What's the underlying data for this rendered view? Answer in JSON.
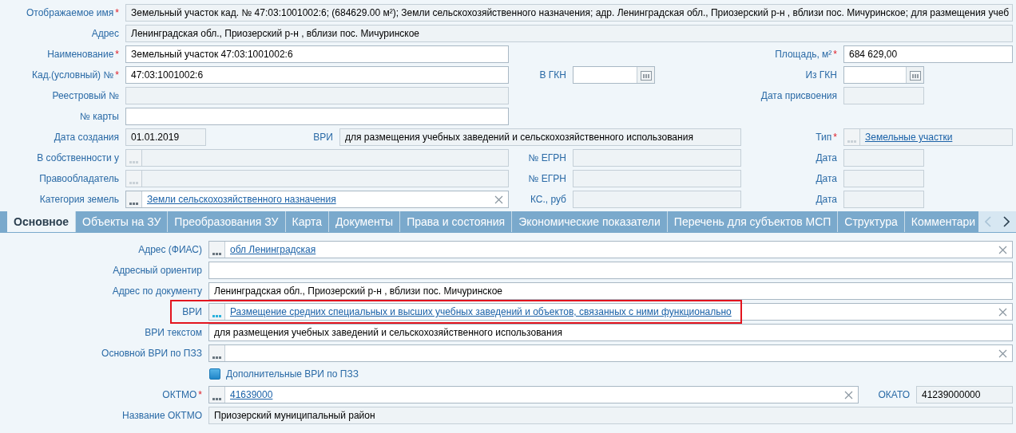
{
  "top_rows": [
    {
      "fields": [
        {
          "label": "Отображаемое имя",
          "required_mark": "*",
          "kind": "readonly",
          "value": "Земельный участок  кад. № 47:03:1001002:6; (684629.00 м²); Земли сельскохозяйственного назначения; адр. Ленинградская обл., Приозерский р-н , вблизи пос. Мичуринское; для размещения учеб"
        }
      ]
    },
    {
      "fields": [
        {
          "label": "Адрес",
          "kind": "readonly",
          "value": "Ленинградская обл., Приозерский р-н , вблизи пос. Мичуринское"
        }
      ]
    },
    {
      "fields": [
        {
          "label": "Наименование",
          "required_mark": "*",
          "kind": "text",
          "value": "Земельный участок 47:03:1001002:6"
        },
        {
          "label": "Площадь, м²",
          "required_mark": "*",
          "kind": "text",
          "value": "684 629,00"
        }
      ]
    },
    {
      "fields": [
        {
          "label": "Кад.(условный) №",
          "required_mark": "*",
          "kind": "text",
          "value": "47:03:1001002:6"
        },
        {
          "label": "В ГКН",
          "kind": "date"
        },
        {
          "label": "Из ГКН",
          "kind": "date"
        }
      ]
    },
    {
      "fields": [
        {
          "label": "Реестровый №",
          "kind": "readonly"
        },
        {
          "label": "Дата присвоения",
          "kind": "readonly"
        }
      ]
    },
    {
      "fields": [
        {
          "label": "№ карты",
          "kind": "text"
        }
      ]
    },
    {
      "fields": [
        {
          "label": "Дата создания",
          "kind": "readonly",
          "value": "01.01.2019"
        },
        {
          "label": "ВРИ",
          "kind": "readonly",
          "value": "для размещения учебных заведений и сельскохозяйственного использования"
        },
        {
          "label": "Тип",
          "required_mark": "*",
          "kind": "lookup",
          "disabled": true,
          "value": "Земельные участки"
        }
      ]
    },
    {
      "fields": [
        {
          "label": "В собственности у",
          "kind": "lookup",
          "disabled": true
        },
        {
          "label": "№ ЕГРН",
          "kind": "readonly"
        },
        {
          "label": "Дата",
          "kind": "readonly"
        }
      ]
    },
    {
      "fields": [
        {
          "label": "Правообладатель",
          "kind": "lookup",
          "disabled": true
        },
        {
          "label": "№ ЕГРН",
          "kind": "readonly"
        },
        {
          "label": "Дата",
          "kind": "readonly"
        }
      ]
    },
    {
      "fields": [
        {
          "label": "Категория земель",
          "kind": "lookup",
          "disabled": false,
          "value": "Земли сельскохозяйственного назначения"
        },
        {
          "label": "КС., руб",
          "kind": "readonly"
        },
        {
          "label": "Дата",
          "kind": "readonly"
        }
      ]
    }
  ],
  "tabs": [
    {
      "label": "Основное",
      "selected": true
    },
    {
      "label": "Объекты на ЗУ",
      "selected": false
    },
    {
      "label": "Преобразования ЗУ",
      "selected": false
    },
    {
      "label": "Карта",
      "selected": false
    },
    {
      "label": "Документы",
      "selected": false
    },
    {
      "label": "Права и состояния",
      "selected": false
    },
    {
      "label": "Экономические показатели",
      "selected": false
    },
    {
      "label": "Перечень для субъектов МСП",
      "selected": false
    },
    {
      "label": "Структура",
      "selected": false
    },
    {
      "label": "Комментари",
      "selected": false
    }
  ],
  "bottom_rows": [
    {
      "kind": "fields",
      "fields": [
        {
          "label": "Адрес (ФИАС)",
          "kind": "lookup",
          "disabled": false,
          "value": "обл Ленинградская"
        }
      ]
    },
    {
      "kind": "fields",
      "fields": [
        {
          "label": "Адресный ориентир",
          "kind": "text"
        }
      ]
    },
    {
      "kind": "fields",
      "fields": [
        {
          "label": "Адрес по документу",
          "kind": "text",
          "value": "Ленинградская обл., Приозерский р-н , вблизи пос. Мичуринское"
        }
      ]
    },
    {
      "kind": "fields",
      "highlighted": true,
      "fields": [
        {
          "label": "ВРИ",
          "kind": "lookup",
          "disabled": false,
          "value": "Размещение средних специальных и высших учебных заведений и объектов, связанных с ними функционально"
        }
      ]
    },
    {
      "kind": "fields",
      "fields": [
        {
          "label": "ВРИ текстом",
          "kind": "text",
          "value": "для размещения учебных заведений и сельскохозяйственного использования"
        }
      ]
    },
    {
      "kind": "fields",
      "fields": [
        {
          "label": "Основной ВРИ по ПЗЗ",
          "kind": "lookup",
          "disabled": false
        }
      ]
    },
    {
      "kind": "checkbox",
      "label": "Дополнительные ВРИ по ПЗЗ",
      "checked": false
    },
    {
      "kind": "fields",
      "fields": [
        {
          "label": "ОКТМО",
          "required_mark": "*",
          "kind": "lookup",
          "disabled": false,
          "value": "41639000"
        },
        {
          "label": "ОКАТО",
          "kind": "readonly",
          "value": "41239000000"
        }
      ]
    },
    {
      "kind": "fields",
      "fields": [
        {
          "label": "Название ОКТМО",
          "kind": "readonly",
          "value": "Приозерский муниципальный район"
        }
      ]
    }
  ]
}
